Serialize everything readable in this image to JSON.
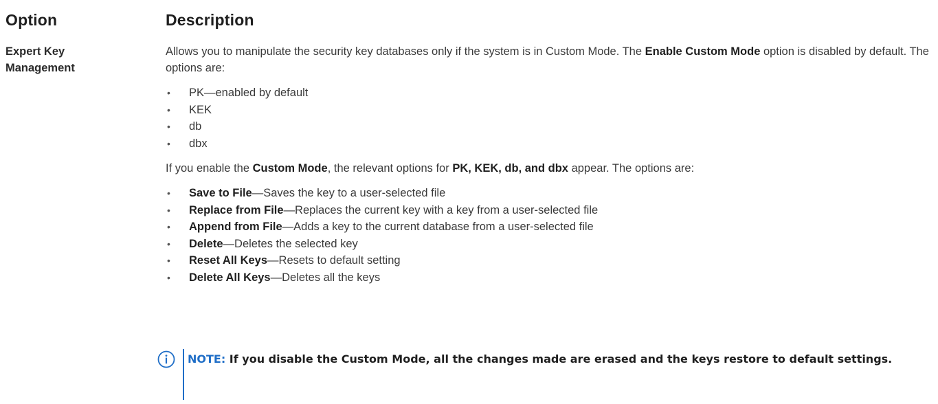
{
  "header": {
    "option_label": "Option",
    "description_label": "Description"
  },
  "option": {
    "name": "Expert Key Management"
  },
  "description": {
    "intro_part1": "Allows you to manipulate the security key databases only if the system is in Custom Mode. The ",
    "intro_bold": "Enable Custom Mode",
    "intro_part2": " option is disabled by default. The options are:",
    "default_keys": [
      "PK—enabled by default",
      "KEK",
      "db",
      "dbx"
    ],
    "custom_intro_part1": "If you enable the ",
    "custom_intro_bold1": "Custom Mode",
    "custom_intro_part2": ", the relevant options for ",
    "custom_intro_bold2": "PK, KEK, db, and dbx",
    "custom_intro_part3": " appear. The options are:",
    "custom_options": [
      {
        "name": "Save to File",
        "text": "—Saves the key to a user-selected file"
      },
      {
        "name": "Replace from File",
        "text": "—Replaces the current key with a key from a user-selected file"
      },
      {
        "name": "Append from File",
        "text": "—Adds a key to the current database from a user-selected file"
      },
      {
        "name": "Delete",
        "text": "—Deletes the selected key"
      },
      {
        "name": "Reset All Keys",
        "text": "—Resets to default setting"
      },
      {
        "name": "Delete All Keys",
        "text": "—Deletes all the keys"
      }
    ]
  },
  "note": {
    "label": "NOTE:",
    "text": " If you disable the Custom Mode, all the changes made are erased and the keys restore to default settings.",
    "icon": "info-icon",
    "accent_color": "#1f6ec7"
  }
}
